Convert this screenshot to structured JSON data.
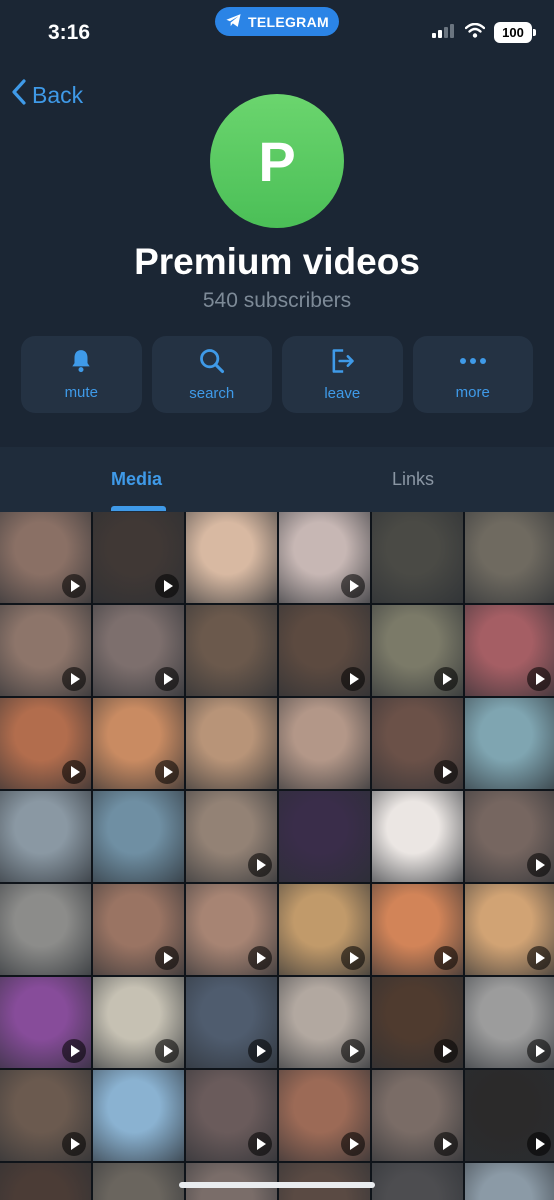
{
  "status": {
    "time": "3:16",
    "app_pill": "TELEGRAM",
    "battery": "100"
  },
  "nav": {
    "back_label": "Back"
  },
  "channel": {
    "avatar_letter": "P",
    "title": "Premium videos",
    "subscribers": "540 subscribers"
  },
  "actions": [
    {
      "label": "mute",
      "icon": "bell-icon"
    },
    {
      "label": "search",
      "icon": "search-icon"
    },
    {
      "label": "leave",
      "icon": "leave-icon"
    },
    {
      "label": "more",
      "icon": "more-icon"
    }
  ],
  "tabs": {
    "media": "Media",
    "links": "Links"
  },
  "colors": {
    "accent": "#3f9ae8",
    "background": "#1b2634",
    "avatar": "#5ac85f",
    "telegram_pill": "#2b84e6"
  },
  "media_grid": [
    {
      "bg": "#8a7065",
      "play": true
    },
    {
      "bg": "#403835",
      "play": true
    },
    {
      "bg": "#d8b9a2",
      "play": false
    },
    {
      "bg": "#c7b7b4",
      "play": true
    },
    {
      "bg": "#4a4a45",
      "play": false
    },
    {
      "bg": "#6f6a60",
      "play": false
    },
    {
      "bg": "#8d756a",
      "play": true
    },
    {
      "bg": "#7d6f6d",
      "play": true
    },
    {
      "bg": "#6b594c",
      "play": false
    },
    {
      "bg": "#5c4a40",
      "play": true
    },
    {
      "bg": "#7b7a68",
      "play": true
    },
    {
      "bg": "#a55e64",
      "play": true
    },
    {
      "bg": "#b26d4d",
      "play": true
    },
    {
      "bg": "#c98b62",
      "play": true
    },
    {
      "bg": "#b89478",
      "play": false
    },
    {
      "bg": "#b39788",
      "play": false
    },
    {
      "bg": "#6b5148",
      "play": true
    },
    {
      "bg": "#7fa5b1",
      "play": false
    },
    {
      "bg": "#8a98a3",
      "play": false
    },
    {
      "bg": "#6f8fa3",
      "play": false
    },
    {
      "bg": "#938275",
      "play": true
    },
    {
      "bg": "#3a2d4a",
      "play": false
    },
    {
      "bg": "#ebe6e3",
      "play": false
    },
    {
      "bg": "#766660",
      "play": true
    },
    {
      "bg": "#8c8c8a",
      "play": false
    },
    {
      "bg": "#9a7463",
      "play": true
    },
    {
      "bg": "#a78473",
      "play": true
    },
    {
      "bg": "#c19a6a",
      "play": true
    },
    {
      "bg": "#d28458",
      "play": true
    },
    {
      "bg": "#d1a374",
      "play": true
    },
    {
      "bg": "#874c9a",
      "play": true
    },
    {
      "bg": "#c6c1b3",
      "play": true
    },
    {
      "bg": "#4f5c6e",
      "play": true
    },
    {
      "bg": "#b2a8a0",
      "play": true
    },
    {
      "bg": "#4f3b2f",
      "play": true
    },
    {
      "bg": "#9c9c9c",
      "play": true
    },
    {
      "bg": "#6b5a4f",
      "play": true
    },
    {
      "bg": "#8ab2d1",
      "play": false
    },
    {
      "bg": "#6a5b5b",
      "play": true
    },
    {
      "bg": "#9c6a56",
      "play": true
    },
    {
      "bg": "#7a6c66",
      "play": true
    },
    {
      "bg": "#2b2a2a",
      "play": true
    },
    {
      "bg": "#4b3c36",
      "play": false
    },
    {
      "bg": "#6a655e",
      "play": false
    },
    {
      "bg": "#7a6d69",
      "play": false
    },
    {
      "bg": "#5a4a43",
      "play": false
    },
    {
      "bg": "#4d4d50",
      "play": false
    },
    {
      "bg": "#8b9aa6",
      "play": false
    }
  ]
}
